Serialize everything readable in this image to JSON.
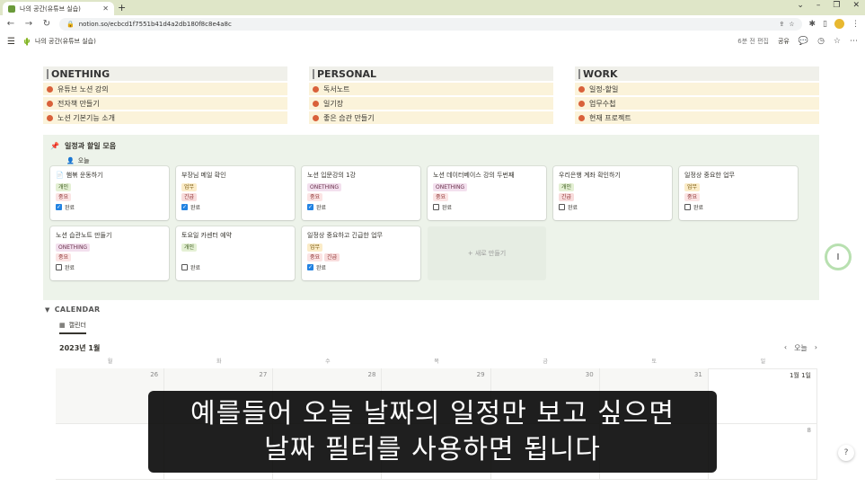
{
  "browser": {
    "tab_title": "나의 공간(유튜브 실습)",
    "url": "notion.so/ecbcd1f7551b41d4a2db180f8c8e4a8c"
  },
  "topbar": {
    "breadcrumb": "나의 공간(유튜브 실습)",
    "edited": "6분 전 편집",
    "share": "공유"
  },
  "columns": [
    {
      "title": "ONETHING",
      "items": [
        "유튜브 노션 강의",
        "전자책 만들기",
        "노션 기본기능 소개"
      ]
    },
    {
      "title": "PERSONAL",
      "items": [
        "독서노트",
        "일기장",
        "좋은 습관 만들기"
      ]
    },
    {
      "title": "WORK",
      "items": [
        "일정-할일",
        "업무수첩",
        "현재 프로젝트"
      ]
    }
  ],
  "board": {
    "title": "일정과 할일 모음",
    "view_tab": "오늘",
    "new_label": "+ 새로 만들기",
    "cards": [
      {
        "title": "햄볶 운동하기",
        "tags1": [
          [
            "개인",
            "gaein"
          ]
        ],
        "tags2": [
          [
            "중요",
            "jungyo"
          ]
        ],
        "done": true,
        "done_label": "완료"
      },
      {
        "title": "부장님 메일 확인",
        "tags1": [
          [
            "업무",
            "upmu"
          ]
        ],
        "tags2": [
          [
            "긴급",
            "gingeup"
          ]
        ],
        "done": true,
        "done_label": "완료"
      },
      {
        "title": "노션 입문강의 1강",
        "tags1": [
          [
            "ONETHING",
            "onething"
          ]
        ],
        "tags2": [
          [
            "중요",
            "jungyo"
          ]
        ],
        "done": true,
        "done_label": "완료"
      },
      {
        "title": "노션 데이터베이스 강의 두번째",
        "tags1": [
          [
            "ONETHING",
            "onething"
          ]
        ],
        "tags2": [
          [
            "중요",
            "jungyo"
          ]
        ],
        "done": false,
        "done_label": "완료"
      },
      {
        "title": "우리은행 계좌 확인하기",
        "tags1": [
          [
            "개인",
            "gaein"
          ]
        ],
        "tags2": [
          [
            "긴급",
            "gingeup"
          ]
        ],
        "done": false,
        "done_label": "완료"
      },
      {
        "title": "일정상 중요한 업무",
        "tags1": [
          [
            "업무",
            "upmu"
          ]
        ],
        "tags2": [
          [
            "중요",
            "jungyo"
          ]
        ],
        "done": false,
        "done_label": "완료"
      },
      {
        "title": "노션 습관노트 만들기",
        "tags1": [
          [
            "ONETHING",
            "onething"
          ]
        ],
        "tags2": [
          [
            "중요",
            "jungyo"
          ]
        ],
        "done": false,
        "done_label": "완료"
      },
      {
        "title": "토요일 카센터 예약",
        "tags1": [
          [
            "개인",
            "gaein"
          ]
        ],
        "tags2": [],
        "done": false,
        "done_label": "완료"
      },
      {
        "title": "일정상 중요하고 긴급한 업무",
        "tags1": [
          [
            "업무",
            "upmu"
          ]
        ],
        "tags2": [
          [
            "중요",
            "jungyo"
          ],
          [
            "긴급",
            "gingeup"
          ]
        ],
        "done": true,
        "done_label": "완료"
      }
    ]
  },
  "calendar": {
    "heading": "CALENDAR",
    "view_tab": "캘린더",
    "month": "2023년 1월",
    "today": "오늘",
    "dow": [
      "월",
      "화",
      "수",
      "목",
      "금",
      "토",
      "일"
    ],
    "weeks": [
      [
        "26",
        "27",
        "28",
        "29",
        "30",
        "31",
        "1월 1일"
      ],
      [
        "",
        "",
        "",
        "",
        "",
        "",
        "8"
      ]
    ]
  },
  "subtitle": {
    "line1": "예를들어 오늘 날짜의 일정만 보고 싶으면",
    "line2": "날짜 필터를 사용하면 됩니다"
  },
  "colors": {
    "accent": "#2383e2",
    "bullet": "#d9613a",
    "board_bg": "#edf3ea",
    "item_bg": "#fbf3da"
  }
}
